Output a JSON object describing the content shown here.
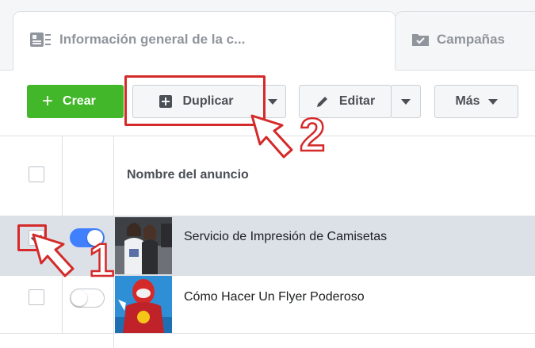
{
  "tabs": [
    {
      "label": "Información general de la c...",
      "icon": "overview-icon",
      "active": true
    },
    {
      "label": "Campañas",
      "icon": "campaigns-folder-icon",
      "active": false
    }
  ],
  "toolbar": {
    "create_label": "Crear",
    "duplicate_label": "Duplicar",
    "edit_label": "Editar",
    "more_label": "Más"
  },
  "table": {
    "header_name": "Nombre del anuncio",
    "rows": [
      {
        "name": "Servicio de Impresión de Camisetas",
        "selected": true,
        "active": true
      },
      {
        "name": "Cómo Hacer Un Flyer Poderoso",
        "selected": false,
        "active": false
      }
    ]
  },
  "annotations": {
    "step1": "1",
    "step2": "2"
  },
  "colors": {
    "accent_green": "#42b72a",
    "toggle_blue": "#4080ff",
    "annotation_red": "#d42a2a",
    "selected_row": "#dce1e8"
  }
}
